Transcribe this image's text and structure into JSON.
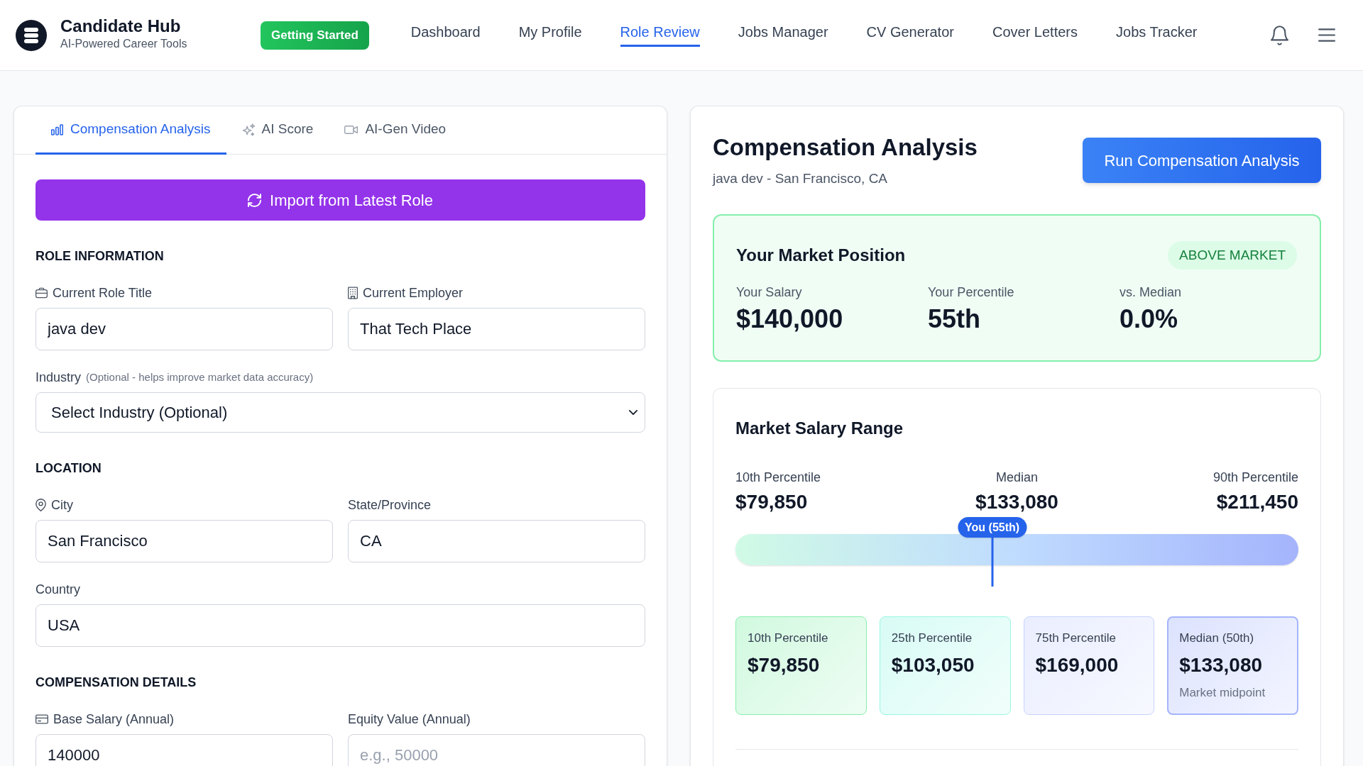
{
  "header": {
    "brand": {
      "title": "Candidate Hub",
      "subtitle": "AI-Powered Career Tools"
    },
    "cta": "Getting Started",
    "nav": [
      {
        "label": "Dashboard",
        "selected": false
      },
      {
        "label": "My Profile",
        "selected": false
      },
      {
        "label": "Role Review",
        "selected": true
      },
      {
        "label": "Jobs Manager",
        "selected": false
      },
      {
        "label": "CV Generator",
        "selected": false
      },
      {
        "label": "Cover Letters",
        "selected": false
      },
      {
        "label": "Jobs Tracker",
        "selected": false
      }
    ]
  },
  "left_panel": {
    "tabs": [
      {
        "label": "Compensation Analysis",
        "selected": true
      },
      {
        "label": "AI Score",
        "selected": false
      },
      {
        "label": "AI-Gen Video",
        "selected": false
      }
    ],
    "import_button": "Import from Latest Role",
    "sections": [
      {
        "title": "ROLE INFORMATION",
        "rows": [
          [
            {
              "label": "Current Role Title",
              "kind": "input",
              "value": "java dev"
            },
            {
              "label": "Current Employer",
              "kind": "input",
              "value": "That Tech Place"
            }
          ],
          [
            {
              "label": "Industry",
              "hint": "(Optional - helps improve market data accuracy)",
              "kind": "select",
              "value": "Select Industry (Optional)"
            }
          ]
        ]
      },
      {
        "title": "LOCATION",
        "rows": [
          [
            {
              "label": "City",
              "kind": "input",
              "value": "San Francisco"
            },
            {
              "label": "State/Province",
              "kind": "input",
              "value": "CA"
            }
          ],
          [
            {
              "label": "Country",
              "kind": "input",
              "value": "USA"
            }
          ]
        ]
      },
      {
        "title": "COMPENSATION DETAILS",
        "rows": [
          [
            {
              "label": "Base Salary (Annual)",
              "kind": "input",
              "value": "140000"
            },
            {
              "label": "Equity Value (Annual)",
              "kind": "input",
              "placeholder": "e.g., 50000"
            }
          ]
        ]
      }
    ]
  },
  "analysis_panel": {
    "title": "Compensation Analysis",
    "subtitle": "java dev - San Francisco, CA",
    "run_button": "Run Compensation Analysis",
    "market_position": {
      "title": "Your Market Position",
      "badge": "ABOVE MARKET",
      "stats": [
        {
          "label": "Your Salary",
          "value": "$140,000"
        },
        {
          "label": "Your Percentile",
          "value": "55th"
        },
        {
          "label": "vs. Median",
          "value": "0.0%"
        }
      ]
    },
    "salary_range": {
      "title": "Market Salary Range",
      "markers": [
        {
          "label": "10th Percentile",
          "value": "$79,850"
        },
        {
          "label": "Median",
          "value": "$133,080"
        },
        {
          "label": "90th Percentile",
          "value": "$211,450"
        }
      ],
      "you": {
        "label": "You (55th)",
        "level": 0.456
      },
      "cards": [
        {
          "label": "10th Percentile",
          "value": "$79,850",
          "color": "#86efac",
          "highlighted": false
        },
        {
          "label": "25th Percentile",
          "value": "$103,050",
          "color": "#99f6e4",
          "highlighted": false
        },
        {
          "label": "75th Percentile",
          "value": "$169,000",
          "color": "#c7d2fe",
          "highlighted": false
        },
        {
          "label": "Median (50th)",
          "value": "$133,080",
          "note": "Market midpoint",
          "color": "#a5b4fc",
          "highlighted": true
        }
      ]
    }
  }
}
